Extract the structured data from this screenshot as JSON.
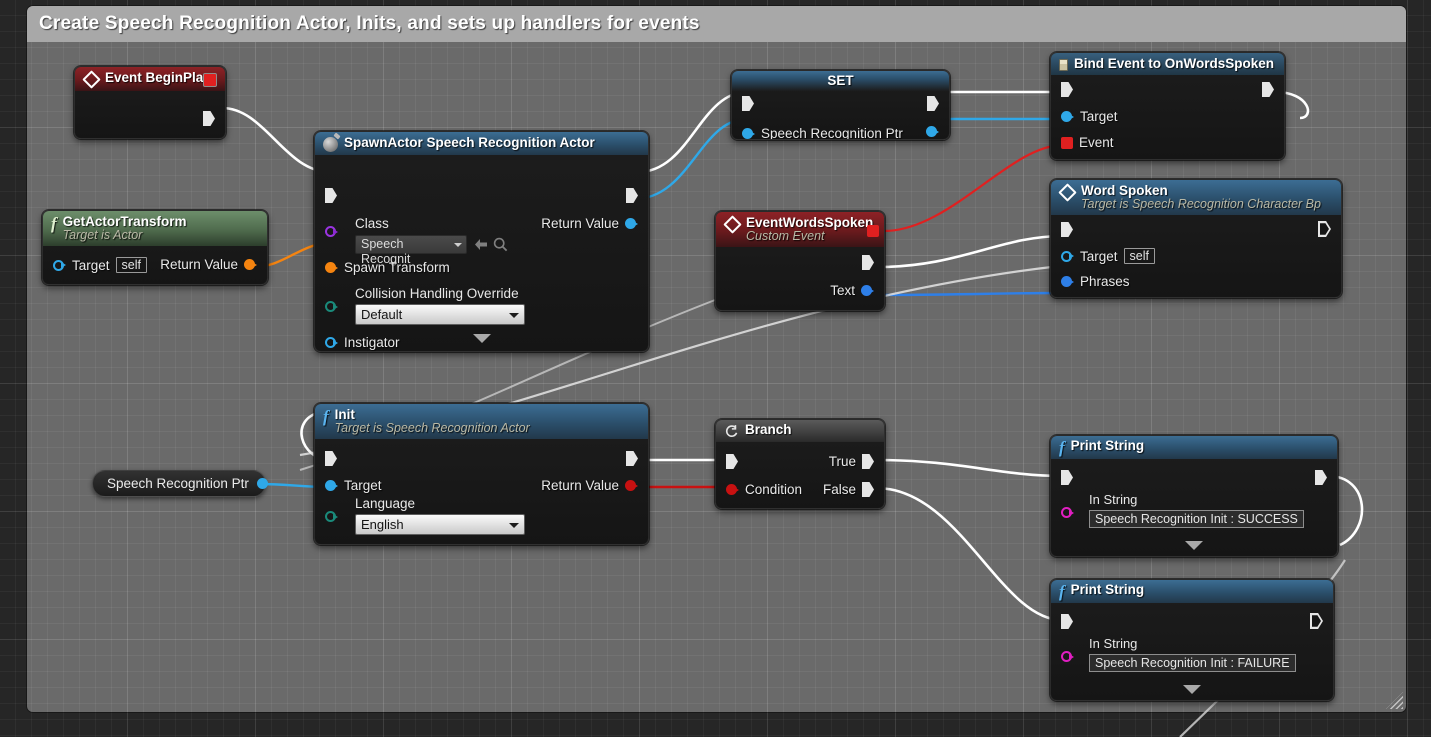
{
  "comment": {
    "title": "Create Speech Recognition Actor, Inits, and sets up handlers for events",
    "resize_grip": "resize-grip"
  },
  "colors": {
    "exec_white": "#ffffff",
    "object_blue": "#30a8e8",
    "bool_red": "#c81111",
    "string_magenta": "#e01ec1",
    "transform_orange": "#f58410",
    "class_purple": "#8c2ad1",
    "enum_teal": "#1a8a7a",
    "delegate_red": "#e02020",
    "header_red": "#8d2226",
    "header_blue": "#3c6d93",
    "header_green": "#6d8e6b",
    "header_grey": "#5a5a5a"
  },
  "nodes": {
    "event_begin_play": {
      "title": "Event BeginPlay",
      "icon": "event-diamond-icon",
      "delegate_pin": "delegate-pin",
      "exec_out": ""
    },
    "get_actor_transform": {
      "title": "GetActorTransform",
      "subtitle": "Target is Actor",
      "icon": "function-f-icon",
      "inputs": [
        {
          "label": "Target",
          "value": "self"
        }
      ],
      "outputs": [
        {
          "label": "Return Value"
        }
      ]
    },
    "spawn_actor": {
      "title": "SpawnActor Speech Recognition Actor",
      "icon": "spawn-actor-icon",
      "class_label": "Class",
      "class_value": "Speech Recognit",
      "spawn_transform_label": "Spawn Transform",
      "collision_label": "Collision Handling Override",
      "collision_value": "Default",
      "instigator_label": "Instigator",
      "return_label": "Return Value",
      "expander": "expand-arrow"
    },
    "set_node": {
      "title": "SET",
      "input_label": "Speech Recognition Ptr"
    },
    "bind_event": {
      "title": "Bind Event to OnWordsSpoken",
      "icon": "delegate-book-icon",
      "inputs": [
        {
          "label": "Target"
        },
        {
          "label": "Event"
        }
      ]
    },
    "word_spoken": {
      "title": "Word Spoken",
      "subtitle": "Target is Speech Recognition Character Bp",
      "icon": "event-diamond-icon",
      "inputs": [
        {
          "label": "Target",
          "value": "self"
        },
        {
          "label": "Phrases"
        }
      ]
    },
    "event_words_spoken": {
      "title": "EventWordsSpoken",
      "subtitle": "Custom Event",
      "icon": "event-diamond-icon",
      "delegate_pin": "delegate-pin",
      "outputs": [
        {
          "label": "Text"
        }
      ]
    },
    "init": {
      "title": "Init",
      "subtitle": "Target is Speech Recognition Actor",
      "icon": "function-f-icon",
      "inputs": [
        {
          "label": "Target"
        }
      ],
      "language_label": "Language",
      "language_value": "English",
      "outputs": [
        {
          "label": "Return Value"
        }
      ]
    },
    "speech_recognition_ptr_getter": {
      "label": "Speech Recognition Ptr"
    },
    "branch": {
      "title": "Branch",
      "icon": "branch-loop-icon",
      "inputs": [
        {
          "label": "Condition"
        }
      ],
      "outputs": [
        {
          "label": "True"
        },
        {
          "label": "False"
        }
      ]
    },
    "print_string_success": {
      "title": "Print String",
      "icon": "function-f-icon",
      "in_string_label": "In String",
      "in_string_value": "Speech Recognition Init : SUCCESS",
      "expander": "expand-arrow"
    },
    "print_string_failure": {
      "title": "Print String",
      "icon": "function-f-icon",
      "in_string_label": "In String",
      "in_string_value": "Speech Recognition Init : FAILURE",
      "expander": "expand-arrow"
    }
  }
}
